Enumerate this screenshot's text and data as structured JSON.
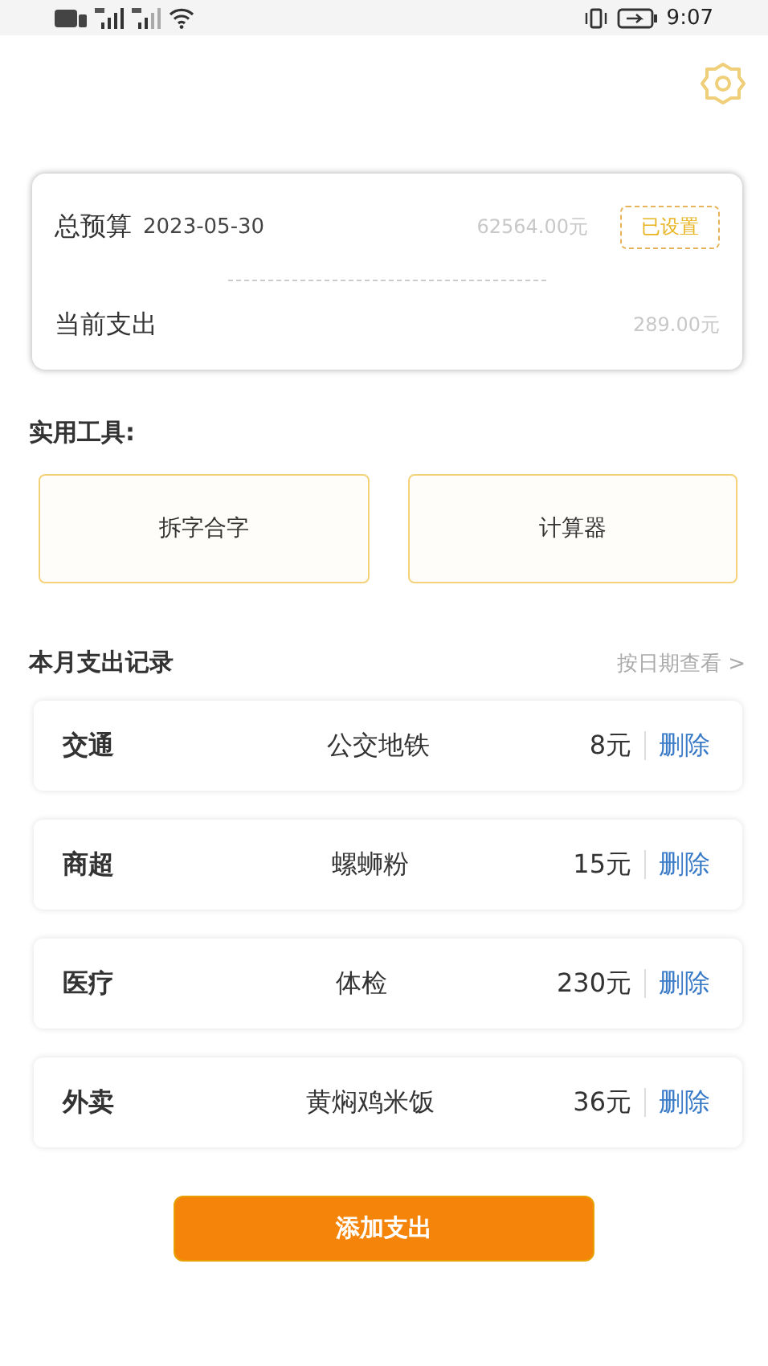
{
  "status_bar": {
    "time": "9:07"
  },
  "budget": {
    "label": "总预算",
    "date": "2023-05-30",
    "amount": "62564.00元",
    "badge": "已设置",
    "spent_label": "当前支出",
    "spent_amount": "289.00元"
  },
  "tools": {
    "title": "实用工具:",
    "items": [
      "拆字合字",
      "计算器"
    ]
  },
  "records": {
    "title": "本月支出记录",
    "link": "按日期查看 >",
    "rows": [
      {
        "category": "交通",
        "item": "公交地铁",
        "amount": "8元",
        "action": "删除"
      },
      {
        "category": "商超",
        "item": "螺蛳粉",
        "amount": "15元",
        "action": "删除"
      },
      {
        "category": "医疗",
        "item": "体检",
        "amount": "230元",
        "action": "删除"
      },
      {
        "category": "外卖",
        "item": "黄焖鸡米饭",
        "amount": "36元",
        "action": "删除"
      }
    ]
  },
  "add_button": "添加支出"
}
